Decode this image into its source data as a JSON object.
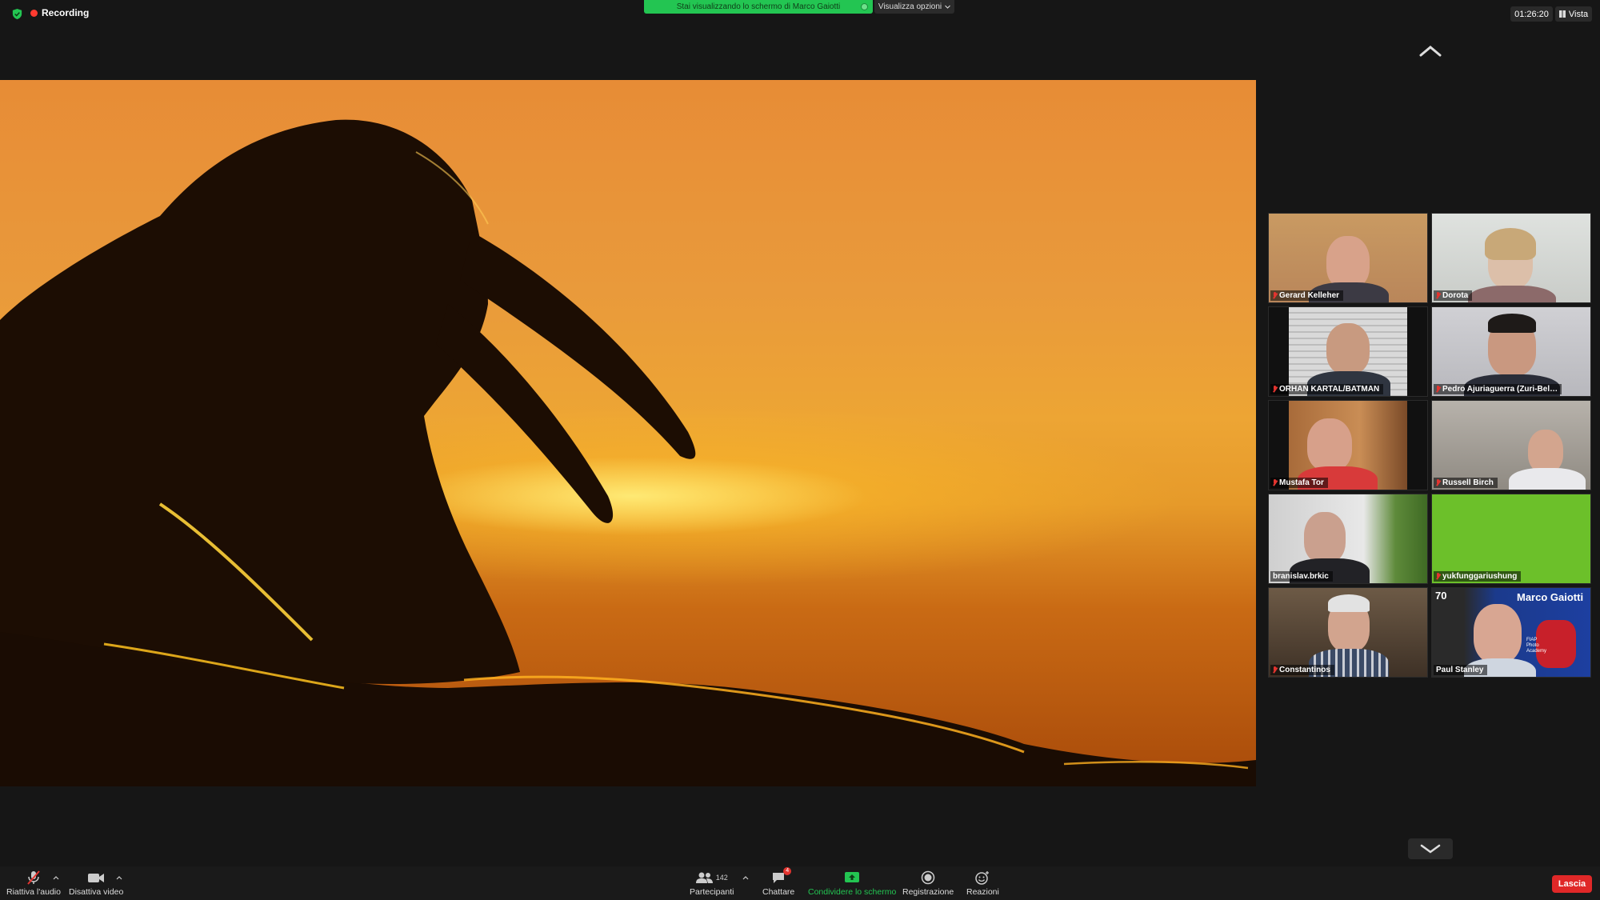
{
  "top_bar": {
    "recording_label": "Recording",
    "share_banner_text": "Stai visualizzando lo schermo di Marco Gaiotti",
    "view_options_label": "Visualizza opzioni",
    "meeting_timer": "01:26:20",
    "view_label": "Vista"
  },
  "participants": [
    {
      "name": "Gerard Kelleher",
      "muted": true
    },
    {
      "name": "Dorota",
      "muted": true
    },
    {
      "name": "ORHAN KARTAL/BATMAN",
      "muted": true
    },
    {
      "name": "Pedro Ajuriaguerra (Zuri-Bel…",
      "muted": true
    },
    {
      "name": "Mustafa Tor",
      "muted": true
    },
    {
      "name": "Russell Birch",
      "muted": true
    },
    {
      "name": "branislav.brkic",
      "muted": false
    },
    {
      "name": "yukfunggariushung",
      "muted": true
    },
    {
      "name": "Constantinos",
      "muted": true
    },
    {
      "name": "Paul Stanley",
      "muted": false
    }
  ],
  "tile_overlay": {
    "title": "Marco Gaiotti",
    "number": "70",
    "org": "FIAP Photo Academy"
  },
  "toolbar": {
    "unmute_label": "Riattiva l'audio",
    "video_label": "Disattiva video",
    "participants_label": "Partecipanti",
    "participants_count": "142",
    "chat_label": "Chattare",
    "chat_badge": "4",
    "share_label": "Condividere lo schermo",
    "record_label": "Registrazione",
    "reactions_label": "Reazioni",
    "leave_label": "Lascia"
  },
  "colors": {
    "accent_green": "#23c552",
    "leave_red": "#e02828",
    "record_red": "#ff3b30"
  }
}
